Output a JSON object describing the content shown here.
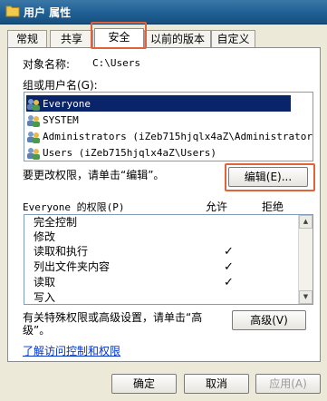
{
  "window": {
    "title": "用户 属性"
  },
  "tabs": [
    "常规",
    "共享",
    "安全",
    "以前的版本",
    "自定义"
  ],
  "security": {
    "object_label": "对象名称:",
    "object_value": "C:\\Users",
    "group_label": "组或用户名(G):",
    "users": [
      "Everyone",
      "SYSTEM",
      "Administrators (iZeb715hjqlx4aZ\\Administrators)",
      "Users (iZeb715hjqlx4aZ\\Users)"
    ],
    "change_perm_text": "要更改权限，请单击“编辑”。",
    "edit_button": "编辑(E)...",
    "perm_header": "Everyone 的权限(P)",
    "allow_header": "允许",
    "deny_header": "拒绝",
    "permissions": [
      {
        "name": "完全控制",
        "allow": false
      },
      {
        "name": "修改",
        "allow": false
      },
      {
        "name": "读取和执行",
        "allow": true
      },
      {
        "name": "列出文件夹内容",
        "allow": true
      },
      {
        "name": "读取",
        "allow": true
      },
      {
        "name": "写入",
        "allow": false
      }
    ],
    "check_mark": "✓",
    "advanced_text_line1": "有关特殊权限或高级设置，请单击“高",
    "advanced_text_line2": "级”。",
    "advanced_button": "高级(V)",
    "link": "了解访问控制和权限"
  },
  "buttons": {
    "ok": "确定",
    "cancel": "取消",
    "apply": "应用(A)"
  },
  "colors": {
    "highlight": "#e0643a",
    "selection": "#0a246a",
    "link": "#0033cc"
  }
}
